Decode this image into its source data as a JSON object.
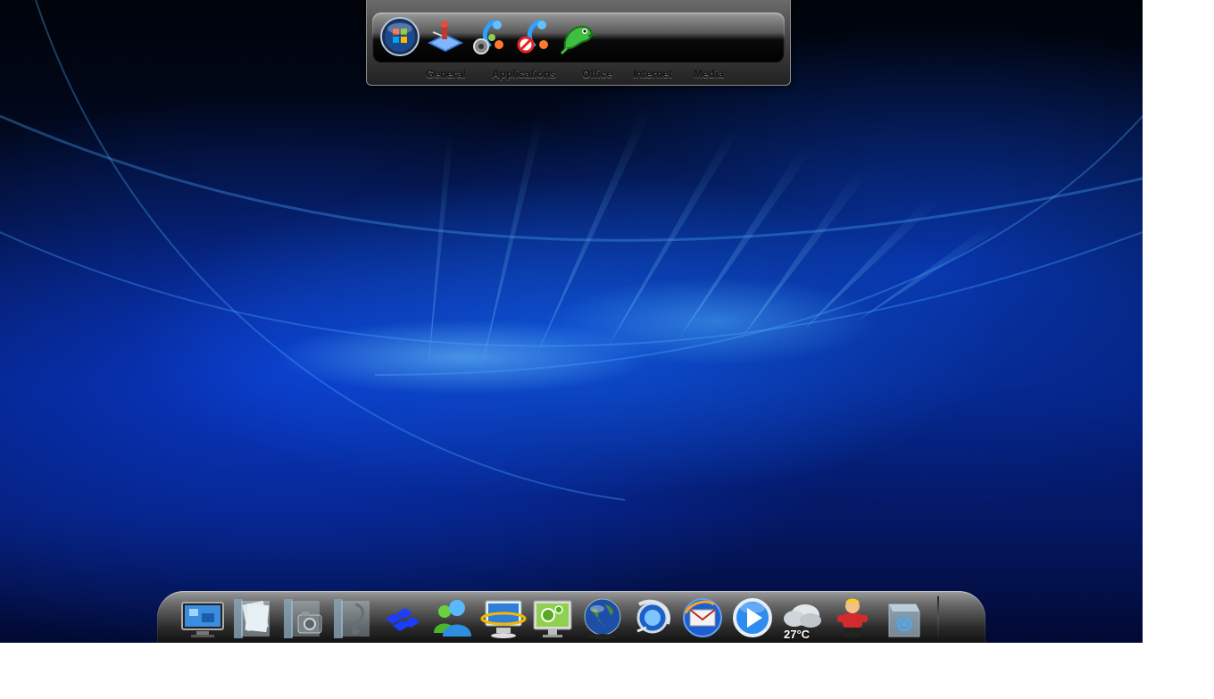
{
  "launcher": {
    "tabs": [
      "General",
      "Applications",
      "Office",
      "Internet",
      "Media"
    ],
    "icons": [
      "windows-start-icon",
      "network-tool-icon",
      "settings-gear-icon",
      "blocked-service-icon",
      "gecko-lizard-icon"
    ]
  },
  "dock": {
    "icons": [
      "monitor-icon",
      "documents-folder-icon",
      "pictures-folder-icon",
      "music-folder-icon",
      "network-share-icon",
      "messenger-icon",
      "computer-icon",
      "control-panel-icon",
      "globe-icon",
      "browser-icon",
      "mail-icon",
      "media-player-icon",
      "weather-icon",
      "character-icon",
      "recycle-bin-icon"
    ],
    "weather": {
      "temp": "27°C"
    }
  },
  "colors": {
    "desktop_blue": "#0a3cd2",
    "dock_gray": "#6a6a6a"
  }
}
